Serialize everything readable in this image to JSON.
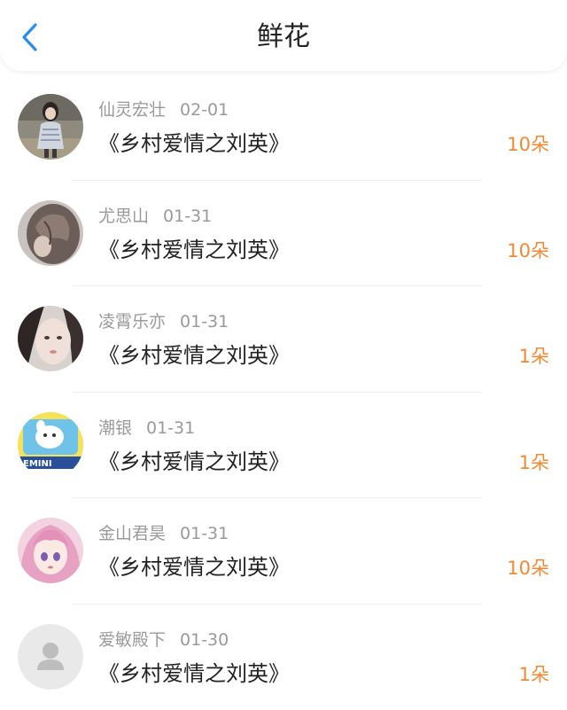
{
  "header": {
    "title": "鲜花",
    "back_icon": "chevron-left-icon",
    "accent_color": "#2a8cf0"
  },
  "count_color": "#f08a36",
  "items": [
    {
      "user": "仙灵宏壮",
      "date": "02-01",
      "work": "《乡村爱情之刘英》",
      "count": "10朵",
      "avatar": "photo-girl"
    },
    {
      "user": "尤思山",
      "date": "01-31",
      "work": "《乡村爱情之刘英》",
      "count": "10朵",
      "avatar": "photo-hair"
    },
    {
      "user": "凌霄乐亦",
      "date": "01-31",
      "work": "《乡村爱情之刘英》",
      "count": "1朵",
      "avatar": "photo-face"
    },
    {
      "user": "潮银",
      "date": "01-31",
      "work": "《乡村爱情之刘英》",
      "count": "1朵",
      "avatar": "cartoon-gemini"
    },
    {
      "user": "金山君昊",
      "date": "01-31",
      "work": "《乡村爱情之刘英》",
      "count": "10朵",
      "avatar": "anime-girl"
    },
    {
      "user": "爱敏殿下",
      "date": "01-30",
      "work": "《乡村爱情之刘英》",
      "count": "1朵",
      "avatar": "default-user-icon"
    }
  ]
}
